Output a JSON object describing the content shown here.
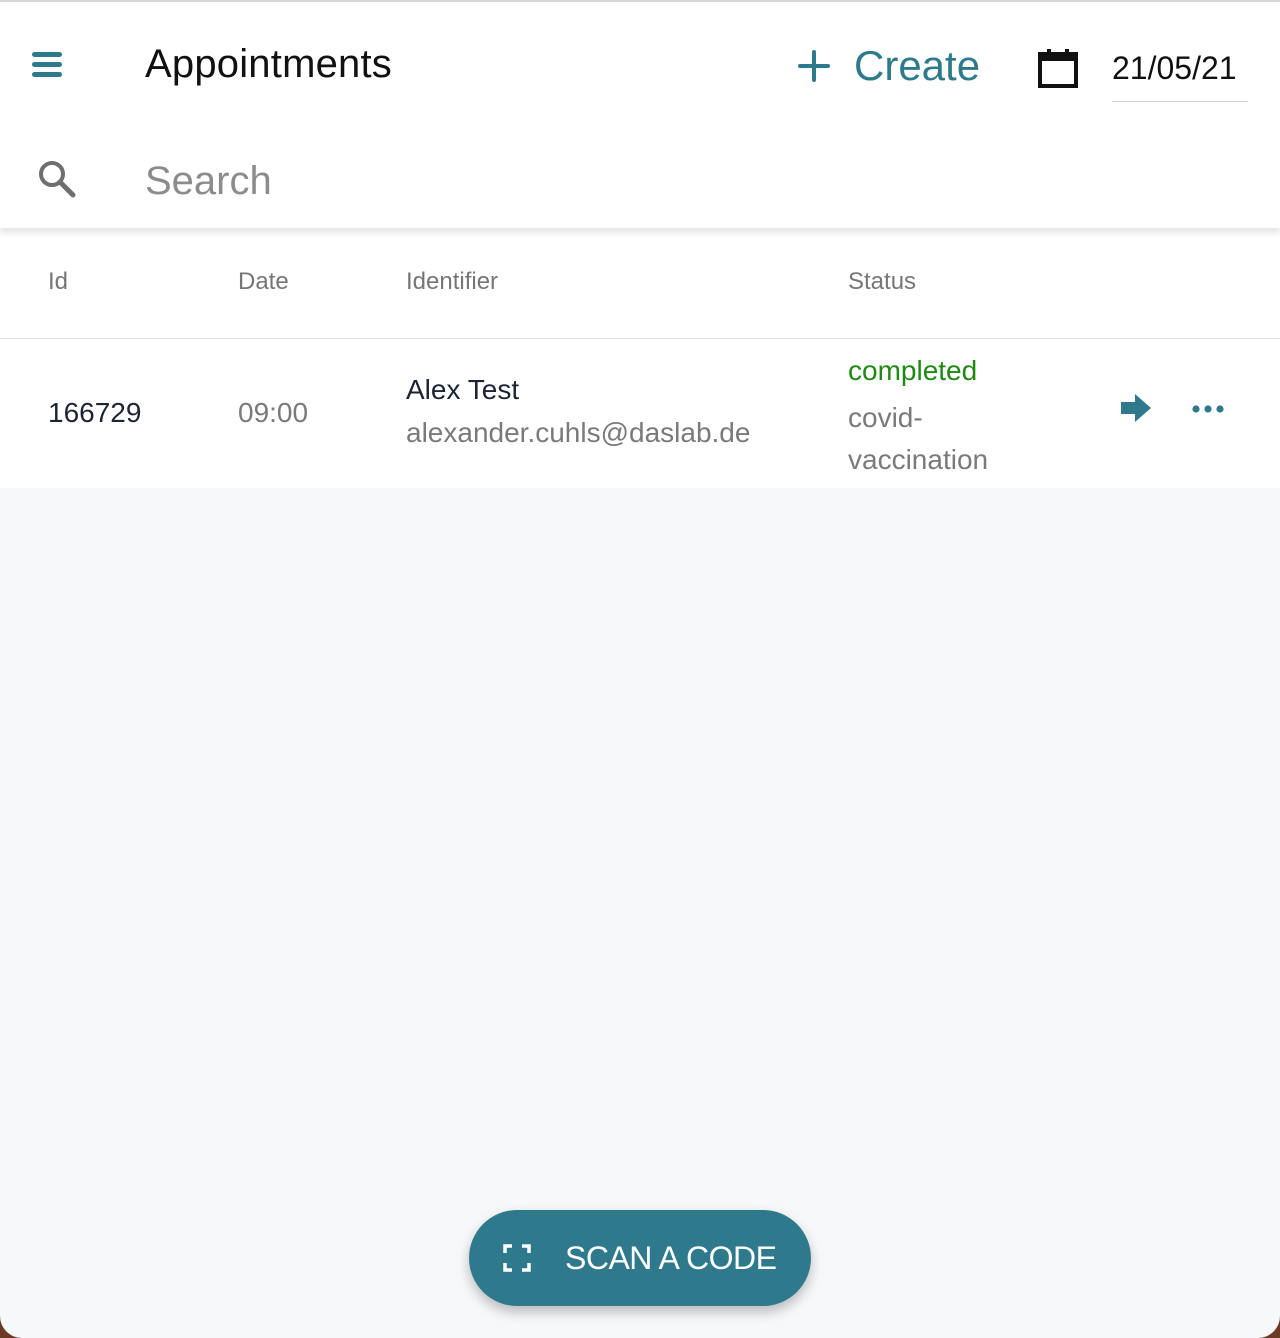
{
  "header": {
    "title": "Appointments",
    "create_label": "Create",
    "date_value": "21/05/21"
  },
  "search": {
    "placeholder": "Search",
    "value": ""
  },
  "table": {
    "columns": [
      "Id",
      "Date",
      "Identifier",
      "Status"
    ],
    "rows": [
      {
        "id": "166729",
        "time": "09:00",
        "name": "Alex Test",
        "email": "alexander.cuhls@daslab.de",
        "status": "completed",
        "type": "covid-vaccination"
      }
    ]
  },
  "fab": {
    "label": "SCAN A CODE"
  },
  "icons": {
    "menu": "menu-icon",
    "create": "plus-icon",
    "calendar": "calendar-icon",
    "search": "search-icon",
    "open": "arrow-right-icon",
    "more": "more-horizontal-icon",
    "scan": "scan-frame-icon"
  },
  "colors": {
    "accent": "#2e7a8c",
    "status_completed": "#1f8a12",
    "background": "#f7f8fa"
  }
}
